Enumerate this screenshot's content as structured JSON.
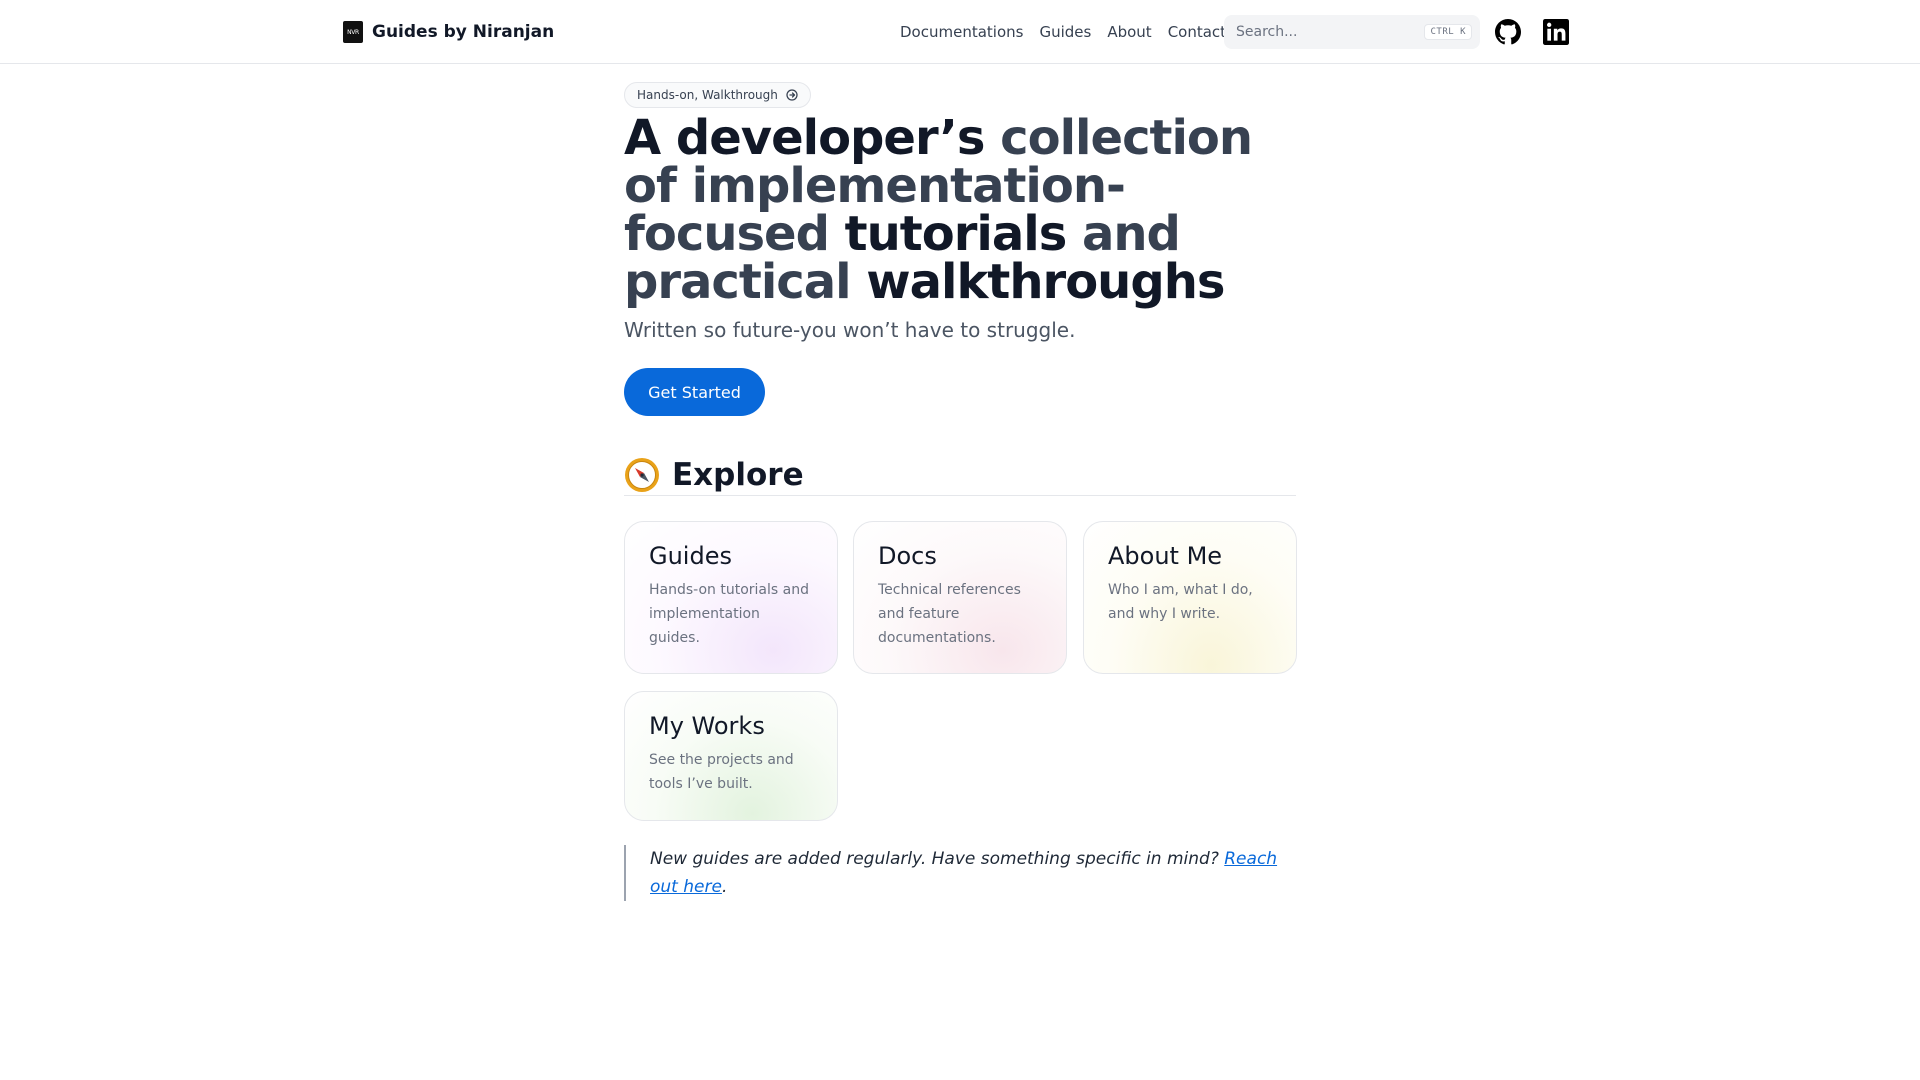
{
  "header": {
    "brand_logo_text": "NVR",
    "brand_title": "Guides by Niranjan",
    "nav": [
      {
        "label": "Documentations"
      },
      {
        "label": "Guides"
      },
      {
        "label": "About"
      },
      {
        "label": "Contact"
      }
    ],
    "search": {
      "placeholder": "Search...",
      "shortcut": "CTRL K"
    },
    "social": [
      {
        "icon": "github-icon"
      },
      {
        "icon": "linkedin-icon"
      }
    ]
  },
  "hero": {
    "badge": "Hands-on, Walkthrough",
    "title_part1": "A developer’s ",
    "title_part2": "collection of implementation-focused",
    "title_part3": " tutorials ",
    "title_part4": "and practical",
    "title_part5": " walkthroughs",
    "subtitle": "Written so future-you won’t have to struggle.",
    "cta_label": "Get Started"
  },
  "explore": {
    "heading": "Explore",
    "icon": "compass-icon",
    "cards": [
      {
        "title": "Guides",
        "description": "Hands-on tutorials and implementation guides."
      },
      {
        "title": "Docs",
        "description": "Technical references and feature documentations."
      },
      {
        "title": "About Me",
        "description": "Who I am, what I do, and why I write."
      },
      {
        "title": "My Works",
        "description": "See the projects and tools I’ve built."
      }
    ]
  },
  "note": {
    "text": "New guides are added regularly. Have something specific in mind? ",
    "link_text": "Reach out here",
    "suffix": "."
  },
  "colors": {
    "accent": "#0969da",
    "text": "#111827",
    "muted_text": "#6b7280"
  }
}
